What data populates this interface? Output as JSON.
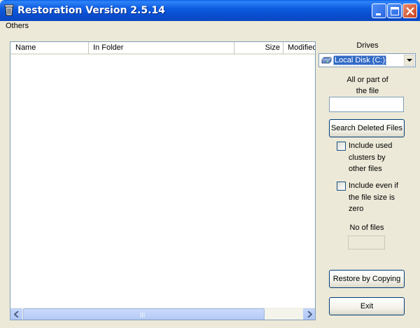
{
  "window": {
    "title": "Restoration Version 2.5.14",
    "controls": [
      "minimize",
      "maximize",
      "close"
    ]
  },
  "menu": {
    "items": [
      {
        "label": "Others"
      }
    ]
  },
  "file_list": {
    "columns": [
      "Name",
      "In Folder",
      "Size",
      "Modified"
    ],
    "rows": [],
    "scrollbar_grip": "|||"
  },
  "drives": {
    "label": "Drives",
    "selected": "Local Disk (C:)",
    "icon": "hard-drive-icon"
  },
  "search": {
    "file_label_line1": "All or part of",
    "file_label_line2": "the file",
    "file_value": "",
    "search_button": "Search Deleted Files"
  },
  "options": {
    "include_used_clusters": {
      "label_lines": [
        "Include used",
        "clusters by",
        "other files"
      ],
      "checked": false
    },
    "include_zero_size": {
      "label_lines": [
        "Include even if",
        "the file size is",
        "zero"
      ],
      "checked": false
    }
  },
  "count": {
    "label": "No of files",
    "value": ""
  },
  "actions": {
    "restore_button": "Restore by Copying",
    "exit_button": "Exit"
  },
  "colors": {
    "titlebar": "#0a4fd0",
    "selection": "#316ac5",
    "window_bg": "#ece9d8",
    "close_button": "#c8421c"
  }
}
